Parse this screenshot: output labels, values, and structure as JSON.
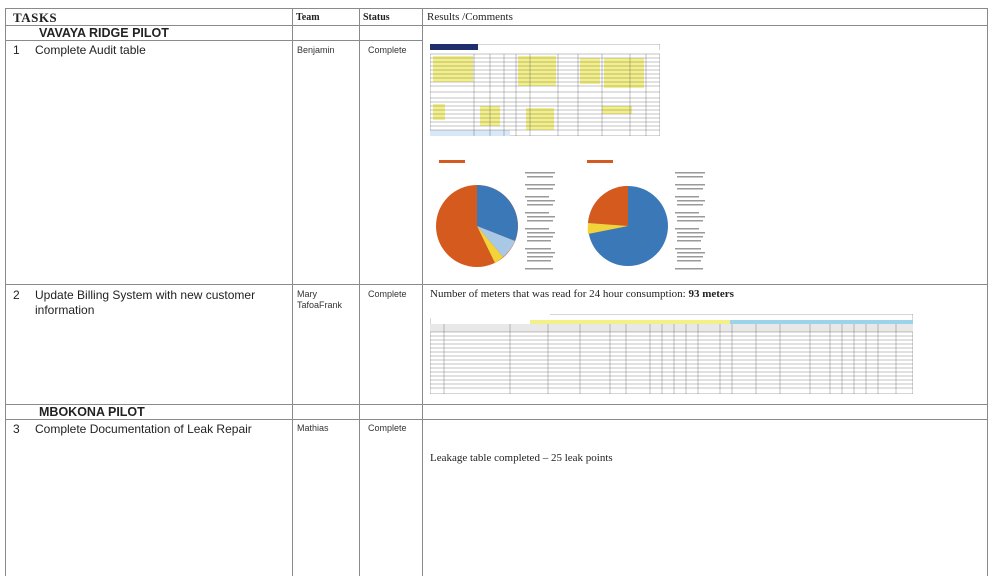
{
  "header": {
    "tasks": "TASKS",
    "team": "Team",
    "status": "Status",
    "results": "Results /Comments"
  },
  "sections": [
    {
      "title": "VAVAYA RIDGE PILOT",
      "tasks": [
        {
          "number": "1",
          "task": "Complete Audit table",
          "team": "Benjamin",
          "status": "Complete",
          "result_text": ""
        },
        {
          "number": "2",
          "task": "Update Billing System with new customer information",
          "team": "Mary TafoaFrank",
          "status": "Complete",
          "result_text": "Number of meters that was read for 24 hour consumption:",
          "result_bold": "93 meters"
        }
      ]
    },
    {
      "title": "MBOKONA PILOT",
      "tasks": [
        {
          "number": "3",
          "task": "Complete Documentation of Leak Repair",
          "team": "Mathias",
          "status": "Complete",
          "result_text": "Leakage table completed – 25 leak points"
        }
      ]
    }
  ],
  "embedded_images": {
    "audit_table_thumbnail": "spreadsheet-thumbnail",
    "pie_chart_left": "pie-chart",
    "pie_chart_right": "pie-chart",
    "billing_table_thumbnail": "spreadsheet-thumbnail"
  },
  "colors": {
    "pie_orange": "#d45a1e",
    "pie_blue": "#3b78b8",
    "pie_light_blue": "#a9c8e6",
    "pie_yellow": "#f2d43a",
    "sheet_yellow": "#f3f08a",
    "sheet_navy": "#1f2f6e",
    "sheet_cyan": "#9ad3ea"
  }
}
